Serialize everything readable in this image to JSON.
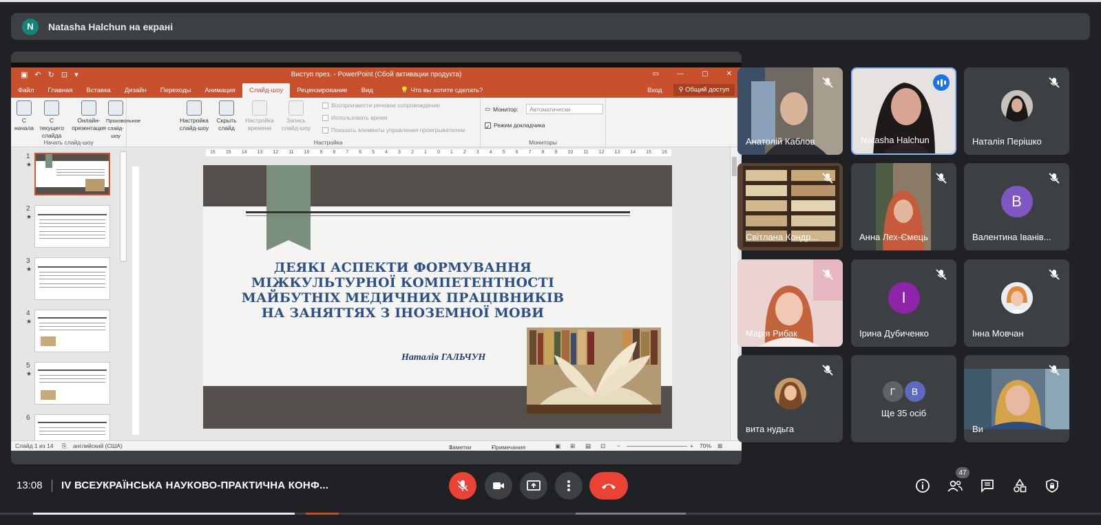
{
  "presenter": {
    "initial": "N",
    "text": "Natasha Halchun на екрані"
  },
  "ppt": {
    "window_title": "Виступ през. - PowerPoint (Сбой активации продукта)",
    "tabs": [
      "Файл",
      "Главная",
      "Вставка",
      "Дизайн",
      "Переходы",
      "Анимация",
      "Слайд-шоу",
      "Рецензирование",
      "Вид"
    ],
    "active_tab": "Слайд-шоу",
    "tell_me": "Что вы хотите сделать?",
    "login": "Вход",
    "share": "Общий доступ",
    "ribbon": {
      "group1_name": "Начать слайд-шоу",
      "btn_from_start": "С начала",
      "btn_from_current": "С текущего слайда",
      "btn_online": "Онлайн-презентация",
      "btn_custom": "Произвольное слайд-шоу",
      "group2_name": "Настройка",
      "btn_setup": "Настройка слайд-шоу",
      "btn_hide": "Скрыть слайд",
      "btn_timing": "Настройка времени",
      "btn_record": "Запись слайд-шоу",
      "chk_narration": "Воспроизвести речевое сопровождение",
      "chk_timings": "Использовать время",
      "chk_controls": "Показать элементы управления проигрывателем",
      "group3_name": "Мониторы",
      "monitor_label": "Монитор:",
      "monitor_value": "Автоматически",
      "presenter_view": "Режим докладчика"
    },
    "ruler_ticks": [
      "16",
      "15",
      "14",
      "13",
      "12",
      "11",
      "10",
      "9",
      "8",
      "7",
      "6",
      "5",
      "4",
      "3",
      "2",
      "1",
      "0",
      "1",
      "2",
      "3",
      "4",
      "5",
      "6",
      "7",
      "8",
      "9",
      "10",
      "11",
      "12",
      "13",
      "14",
      "15",
      "16"
    ],
    "slide_numbers": [
      "1",
      "2",
      "3",
      "4",
      "5",
      "6"
    ],
    "slide": {
      "heading_lines": [
        "ДЕЯКІ АСПЕКТИ ФОРМУВАННЯ",
        "МІЖКУЛЬТУРНОЇ КОМПЕТЕНТНОСТІ",
        "МАЙБУТНІХ МЕДИЧНИХ ПРАЦІВНИКІВ",
        "НА ЗАНЯТТЯХ З ІНОЗЕМНОЇ МОВИ"
      ],
      "author": "Наталія ГАЛЬЧУН"
    },
    "status": {
      "slide_of": "Слайд 1 из 14",
      "language": "английский (США)",
      "notes": "Заметки",
      "comments": "Примечания",
      "zoom": "70%"
    }
  },
  "participants": [
    {
      "name": "Анатолій Каблов",
      "muted": true
    },
    {
      "name": "Natasha Halchun",
      "speaking": true
    },
    {
      "name": "Наталія Перішко",
      "muted": true
    },
    {
      "name": "Світлана Кондр...",
      "muted": true
    },
    {
      "name": "Анна Лех-Ємець",
      "muted": true
    },
    {
      "name": "Валентина Іванів...",
      "muted": true,
      "initial": "В",
      "color": "#7e57c2"
    },
    {
      "name": "Марія Рибак",
      "muted": true
    },
    {
      "name": "Ірина Дубиченко",
      "muted": true,
      "initial": "І",
      "color": "#8e24aa"
    },
    {
      "name": "Інна Мовчан",
      "muted": true
    },
    {
      "name": "вита нудьга",
      "muted": true
    },
    {
      "name": "Ще 35 осіб",
      "initials": [
        "Г",
        "В"
      ],
      "colors": [
        "#5f6368",
        "#5c6bc0"
      ]
    },
    {
      "name": "Ви",
      "muted": true
    }
  ],
  "bottom": {
    "time": "13:08",
    "meeting_title": "IV ВСЕУКРАЇНСЬКА НАУКОВО-ПРАКТИЧНА КОНФ...",
    "participant_count": "47"
  },
  "colors": {
    "ppt_accent": "#c9502c",
    "meet_bg": "#202124",
    "tile_bg": "#3c4043",
    "hangup": "#ea4335",
    "active_speaker": "#8ab4f8"
  }
}
